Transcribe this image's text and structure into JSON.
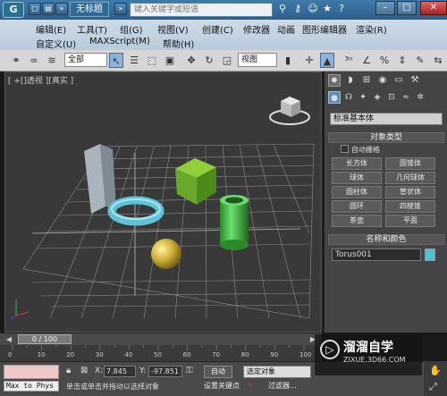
{
  "titlebar": {
    "logo": "G",
    "doc_title": "无标题",
    "search_placeholder": "键入关键字或短语",
    "icons": [
      "binoculars-icon",
      "key-icon",
      "people-icon",
      "star-icon",
      "help-icon"
    ]
  },
  "menu": {
    "row1": [
      "编辑(E)",
      "工具(T)",
      "组(G)",
      "视图(V)",
      "创建(C)",
      "修改器",
      "动画",
      "图形编辑器",
      "渲染(R)"
    ],
    "row2": [
      "自定义(U)",
      "MAXScript(M)",
      "帮助(H)"
    ]
  },
  "toolbar": {
    "selection_filter": "全部",
    "ref_coord": "视图"
  },
  "viewport": {
    "label": "[ +[]透视 ][真实 ]"
  },
  "cmdpanel": {
    "type_dropdown": "标准基本体",
    "object_type_header": "对象类型",
    "autogrid_label": "自动栅格",
    "buttons": [
      "长方体",
      "圆锥体",
      "球体",
      "几何球体",
      "圆柱体",
      "管状体",
      "圆环",
      "四棱锥",
      "茶壶",
      "平面"
    ],
    "name_color_header": "名称和颜色",
    "object_name": "Torus001",
    "object_color": "#4fbfd6"
  },
  "timeline": {
    "frame_display": "0 / 100",
    "ticks": [
      "0",
      "10",
      "20",
      "30",
      "40",
      "50",
      "60",
      "70",
      "80",
      "90",
      "100"
    ]
  },
  "status": {
    "max_to_phys": "Max to Phys",
    "x_label": "X:",
    "x_value": "7.845",
    "y_label": "Y:",
    "y_value": "-97.851",
    "prompt": "单击或单击并拖动以选择对象",
    "auto_key": "自动",
    "set_key": "设置关键点",
    "selection_dropdown": "选定对象",
    "filters": "过滤器..."
  },
  "watermark": {
    "logo": "▷",
    "title": "溜溜自学",
    "url": "ZIXUE.3D66.COM"
  }
}
